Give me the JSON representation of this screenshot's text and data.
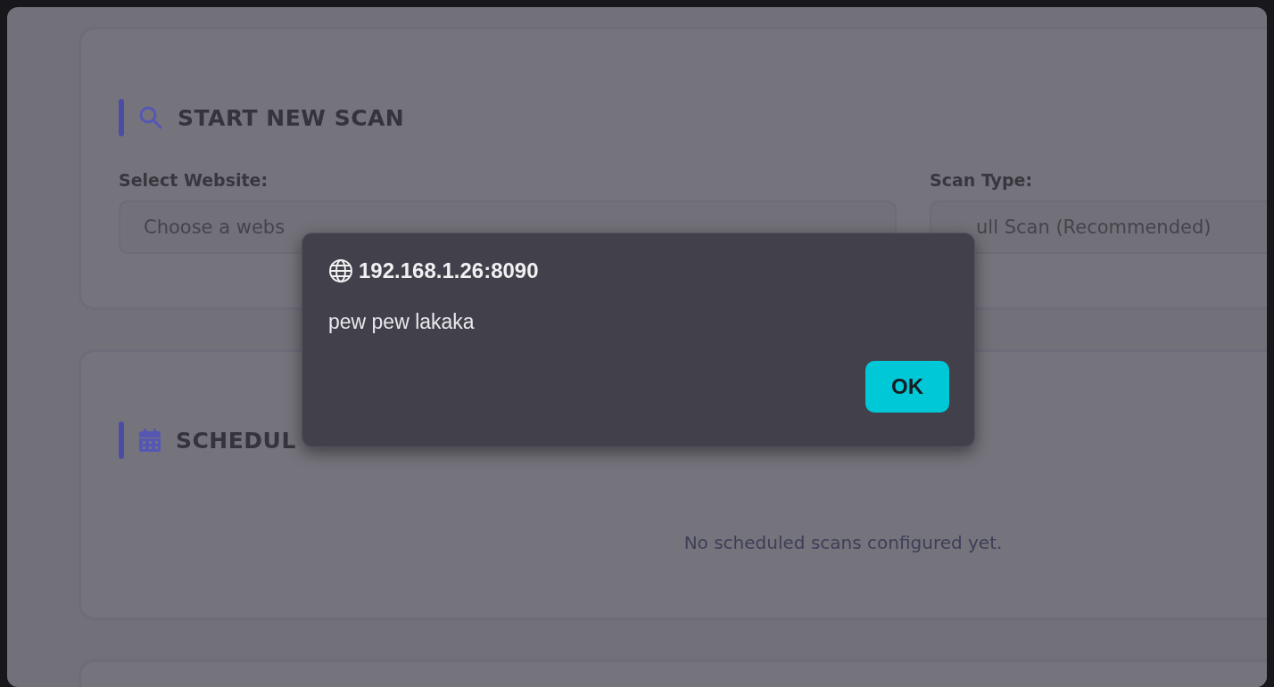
{
  "cards": [
    {
      "kind": "form",
      "title": "START NEW SCAN",
      "fields": [
        {
          "label": "Select Website:",
          "placeholder": "Choose a webs"
        },
        {
          "label": "Scan Type:",
          "value": "ull Scan (Recommended)"
        }
      ]
    },
    {
      "kind": "empty",
      "title": "SCHEDUL",
      "message": "No scheduled scans configured yet."
    },
    {
      "kind": "blank"
    }
  ],
  "dialog": {
    "origin": "192.168.1.26:8090",
    "message": "pew pew lakaka",
    "buttons": [
      "OK"
    ]
  }
}
